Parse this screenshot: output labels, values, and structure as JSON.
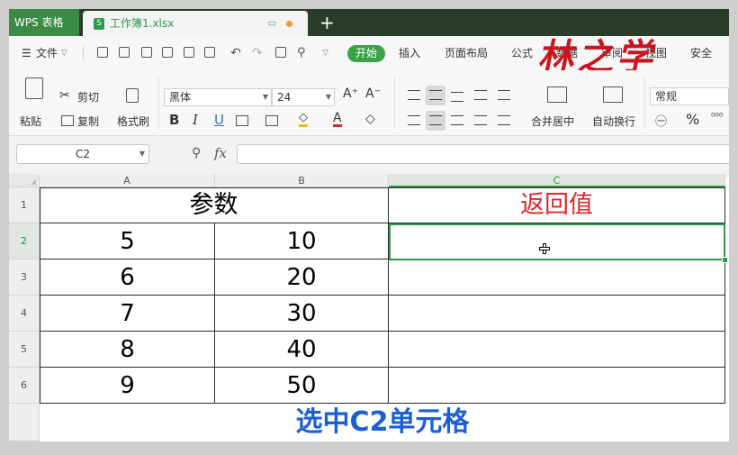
{
  "titlebar": {
    "app_tab": "WPS 表格",
    "file_tab": "工作簿1.xlsx",
    "new_tab": "+",
    "doc_icon": "S"
  },
  "menu": {
    "file": "文件",
    "kaishi": "开始",
    "items": [
      "插入",
      "页面布局",
      "公式",
      "数据",
      "审阅",
      "视图",
      "安全"
    ],
    "watermark": "林之学"
  },
  "ribbon": {
    "paste": "粘贴",
    "cut": "剪切",
    "copy": "复制",
    "format_painter": "格式刷",
    "font_name": "黑体",
    "font_size": "24",
    "bold": "B",
    "italic": "I",
    "underline": "U",
    "merge_center": "合并居中",
    "wrap_text": "自动换行",
    "number_format": "常规",
    "percent": "%"
  },
  "formula_bar": {
    "name_box": "C2",
    "fx": "fx",
    "content": ""
  },
  "sheet": {
    "columns": [
      "A",
      "B",
      "C"
    ],
    "rows": [
      "1",
      "2",
      "3",
      "4",
      "5",
      "6"
    ],
    "header_merged": "参数",
    "return_header": "返回值",
    "data": [
      [
        "5",
        "10"
      ],
      [
        "6",
        "20"
      ],
      [
        "7",
        "30"
      ],
      [
        "8",
        "40"
      ],
      [
        "9",
        "50"
      ]
    ],
    "selected_cell": "C2"
  },
  "caption": "选中C2单元格",
  "colors": {
    "accent_green": "#2f9a49",
    "red_text": "#e0262a",
    "caption_blue": "#1a5fd6"
  }
}
